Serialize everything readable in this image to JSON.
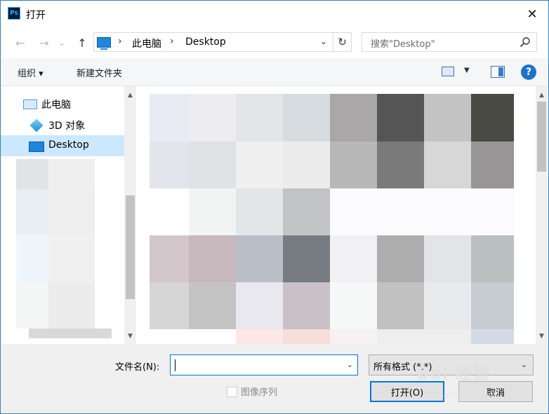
{
  "window": {
    "app_icon_text": "Ps",
    "title": "打开",
    "close_glyph": "✕"
  },
  "nav": {
    "back_glyph": "←",
    "forward_glyph": "→",
    "history_glyph": "⌄",
    "up_glyph": "↑",
    "breadcrumb": [
      "此电脑",
      "Desktop"
    ],
    "breadcrumb_sep": "›",
    "dropdown_glyph": "⌄",
    "refresh_glyph": "↻",
    "search_placeholder": "搜索\"Desktop\""
  },
  "toolbar": {
    "organize_label": "组织 ▾",
    "new_folder_label": "新建文件夹",
    "view_drop_glyph": "▼",
    "help_glyph": "?"
  },
  "sidebar": {
    "items": [
      {
        "label": "此电脑",
        "icon": "computer-icon"
      },
      {
        "label": "3D 对象",
        "icon": "cube-3d-icon"
      },
      {
        "label": "Desktop",
        "icon": "desktop-icon",
        "selected": true
      }
    ]
  },
  "bottom": {
    "filename_label": "文件名(N):",
    "filename_value": "",
    "filetype_value": "所有格式 (*.*)",
    "image_sequence_label": "图像序列",
    "open_button": "打开(O)",
    "cancel_button": "取消"
  },
  "watermark": {
    "main": "Bai 经验",
    "sub": "jingyan.baidu.com"
  },
  "colors": {
    "accent": "#0078d7",
    "selection": "#cce8ff",
    "frame": "#3c7fb1"
  }
}
